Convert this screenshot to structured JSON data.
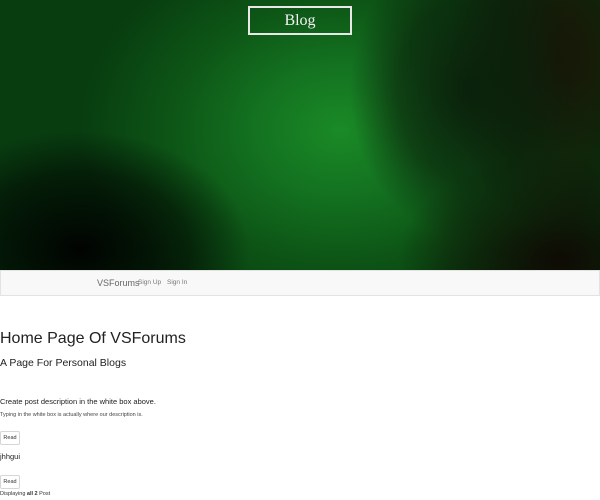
{
  "hero": {
    "badge_text": "Blog"
  },
  "navbar": {
    "brand": "VSForums",
    "links": [
      {
        "label": "Sign Up"
      },
      {
        "label": "Sign In"
      }
    ]
  },
  "main": {
    "title": "Home Page Of VSForums",
    "subtitle": "A Page For Personal Blogs",
    "posts": [
      {
        "title": "Create post description in the white box above.",
        "description": "Typing in the white box is actually where our description is.",
        "button_label": "Read"
      },
      {
        "title": "jhhgui",
        "button_label": "Read"
      }
    ],
    "footer": {
      "prefix": "Displaying ",
      "count_text": "all 2",
      "suffix": " Post"
    }
  },
  "colors": {
    "hero_green": "#137020",
    "navbar_bg": "#f8f8f8"
  }
}
